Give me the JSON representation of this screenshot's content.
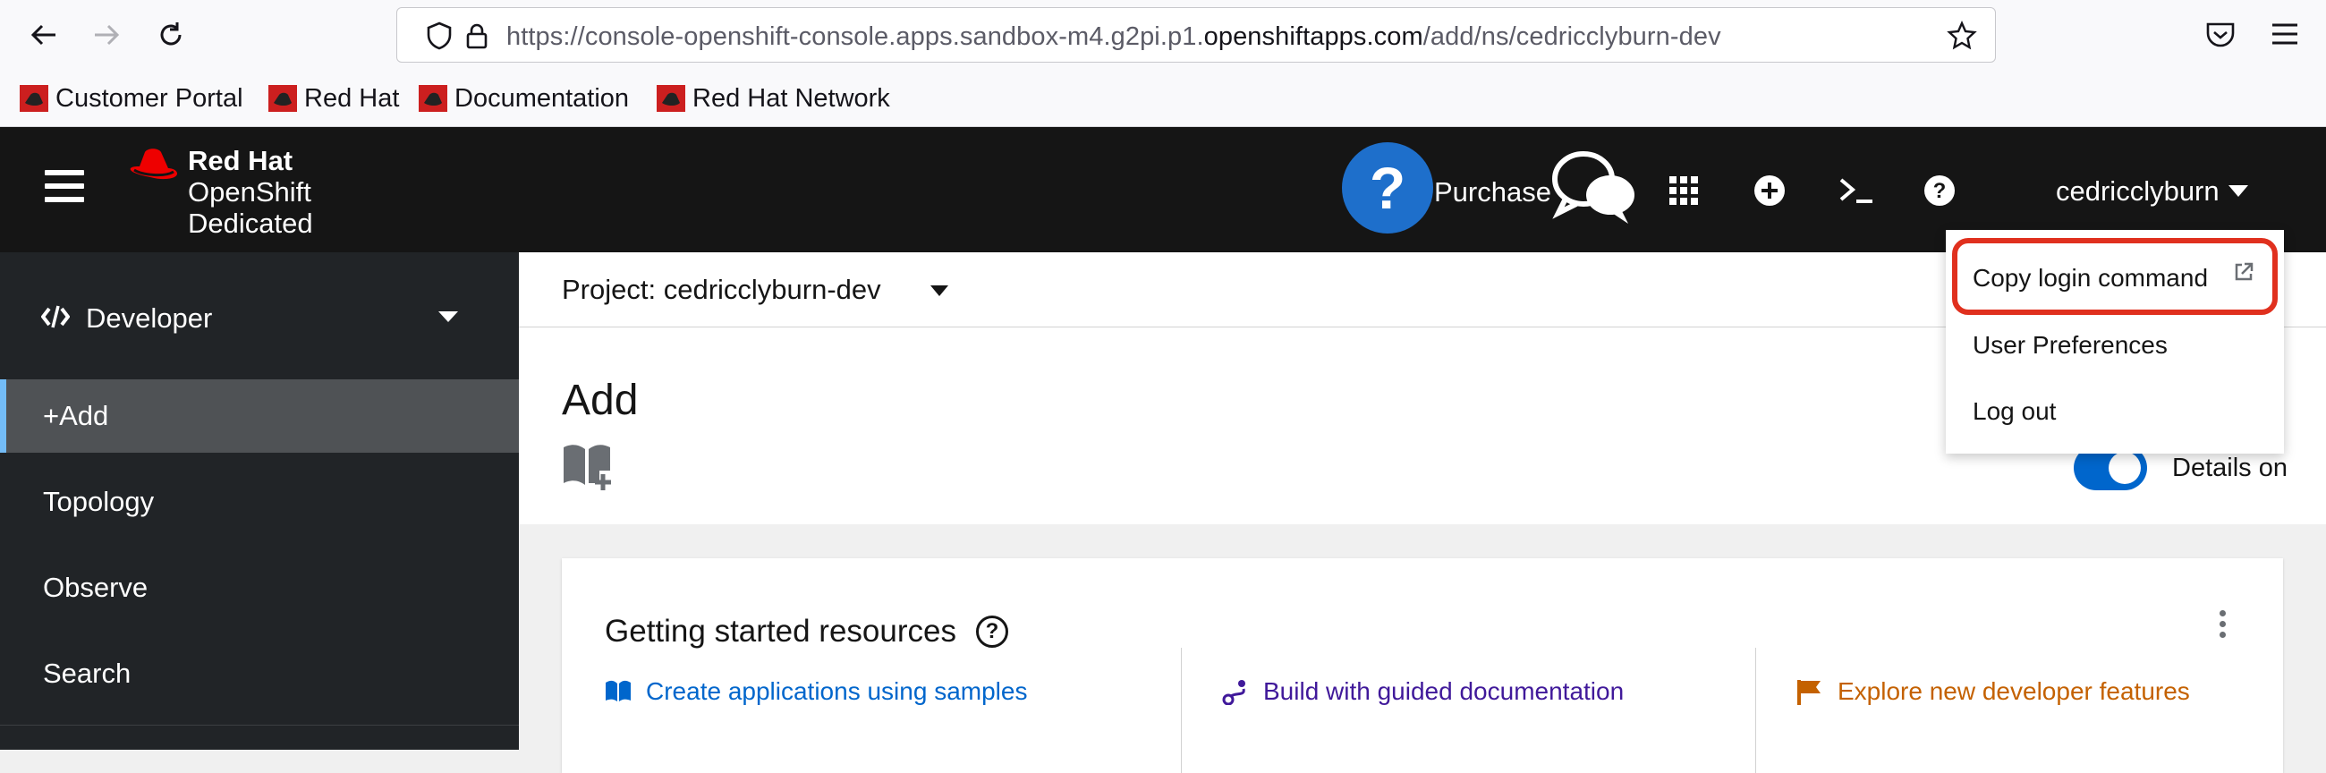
{
  "browser": {
    "url_prefix": "https://console-openshift-console.apps.sandbox-m4.g2pi.p1.",
    "url_domain": "openshiftapps.com",
    "url_suffix": "/add/ns/cedricclyburn-dev",
    "bookmarks": [
      "Customer Portal",
      "Red Hat",
      "Documentation",
      "Red Hat Network"
    ]
  },
  "masthead": {
    "brand_line1": "Red Hat",
    "brand_line2": "OpenShift",
    "brand_line3": "Dedicated",
    "help_glyph": "?",
    "purchase_label": "Purchase",
    "user_name": "cedricclyburn"
  },
  "sidebar": {
    "perspective": "Developer",
    "items": [
      "+Add",
      "Topology",
      "Observe",
      "Search"
    ]
  },
  "main": {
    "project_label": "Project: cedricclyburn-dev",
    "page_title": "Add",
    "details_toggle_label": "Details on",
    "card": {
      "title": "Getting started resources",
      "links": [
        {
          "label": "Create applications using samples",
          "color": "#0066cc"
        },
        {
          "label": "Build with guided documentation",
          "color": "#40199a"
        },
        {
          "label": "Explore new developer features",
          "color": "#c46100"
        }
      ]
    }
  },
  "user_dropdown": {
    "items": [
      "Copy login command",
      "User Preferences",
      "Log out"
    ],
    "highlight_color": "#e0301e"
  },
  "colors": {
    "masthead_bg": "#151515",
    "sidebar_bg": "#212427",
    "active_nav_bg": "#4f5255",
    "active_nav_accent": "#73bcf7",
    "toggle_on": "#0066cc",
    "help_blue": "#1e6fcb"
  }
}
